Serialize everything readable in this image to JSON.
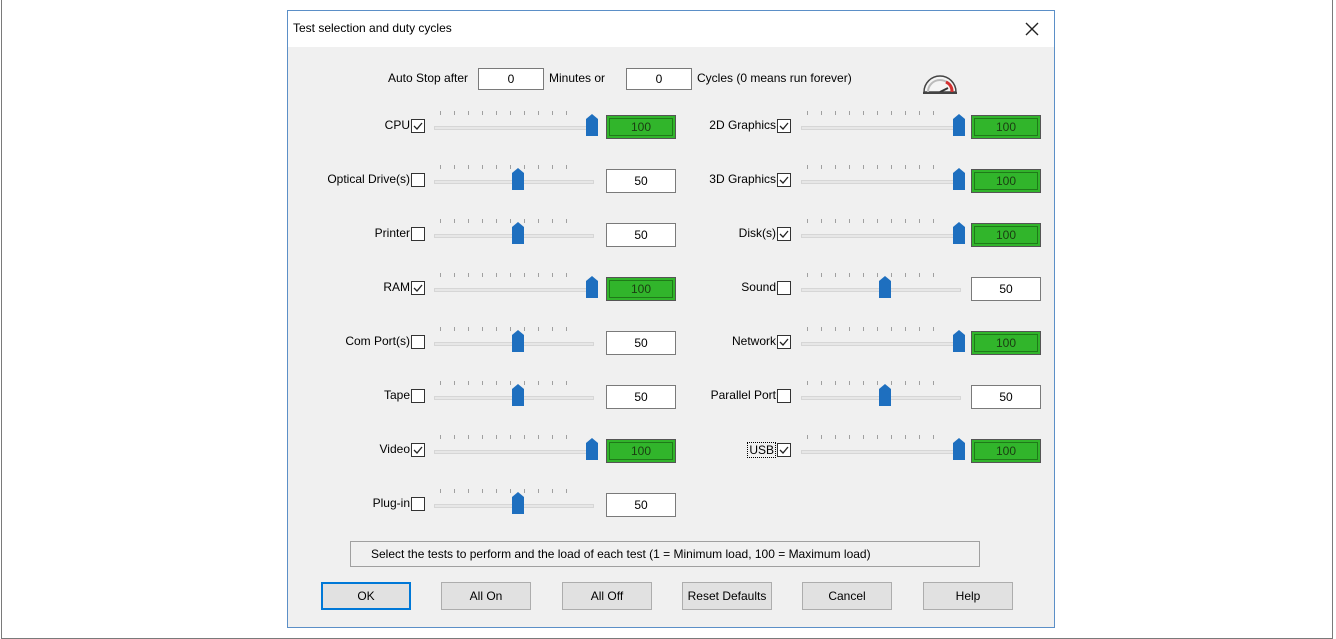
{
  "dialog": {
    "title": "Test selection and duty cycles"
  },
  "autostop": {
    "prefix": "Auto Stop after",
    "minutes_value": "0",
    "minutes_label": "Minutes or",
    "cycles_value": "0",
    "cycles_label": "Cycles (0 means run forever)"
  },
  "tests_left": [
    {
      "label": "CPU",
      "checked": true,
      "value": "100"
    },
    {
      "label": "Optical Drive(s)",
      "checked": false,
      "value": "50"
    },
    {
      "label": "Printer",
      "checked": false,
      "value": "50"
    },
    {
      "label": "RAM",
      "checked": true,
      "value": "100"
    },
    {
      "label": "Com Port(s)",
      "checked": false,
      "value": "50"
    },
    {
      "label": "Tape",
      "checked": false,
      "value": "50"
    },
    {
      "label": "Video",
      "checked": true,
      "value": "100"
    },
    {
      "label": "Plug-in",
      "checked": false,
      "value": "50"
    }
  ],
  "tests_right": [
    {
      "label": "2D Graphics",
      "checked": true,
      "value": "100"
    },
    {
      "label": "3D Graphics",
      "checked": true,
      "value": "100"
    },
    {
      "label": "Disk(s)",
      "checked": true,
      "value": "100"
    },
    {
      "label": "Sound",
      "checked": false,
      "value": "50"
    },
    {
      "label": "Network",
      "checked": true,
      "value": "100"
    },
    {
      "label": "Parallel Port",
      "checked": false,
      "value": "50"
    },
    {
      "label": "USB",
      "checked": true,
      "value": "100"
    }
  ],
  "status": "Select the tests to perform and the load of each test (1 = Minimum load, 100 = Maximum load)",
  "buttons": {
    "ok": "OK",
    "all_on": "All On",
    "all_off": "All Off",
    "reset": "Reset Defaults",
    "cancel": "Cancel",
    "help": "Help"
  },
  "colors": {
    "accent": "#0078d7",
    "active_value": "#31b52b",
    "thumb": "#1e6fbf"
  },
  "icons": {
    "close": "close-icon",
    "gauge": "speedometer-icon",
    "check": "checkmark-icon"
  }
}
